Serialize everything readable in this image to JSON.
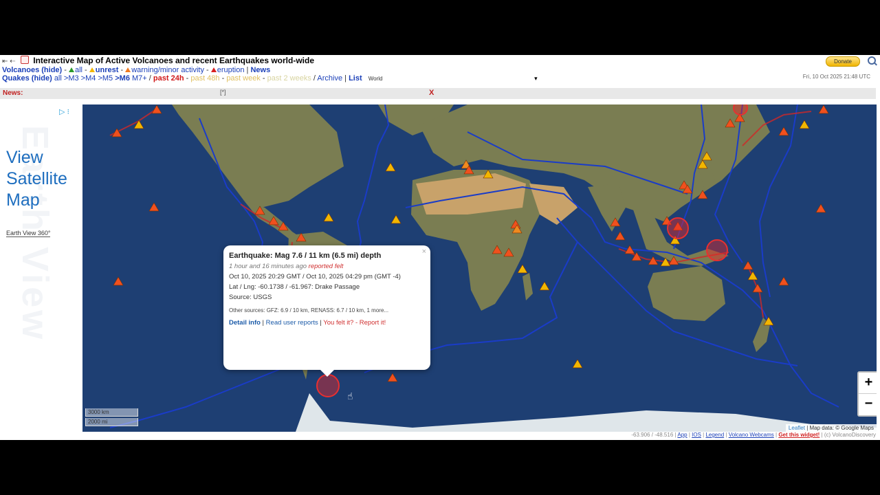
{
  "header": {
    "mini_icons": "⇤ ⇠",
    "title": "Interactive Map of Active Volcanoes and recent Earthquakes world-wide",
    "volcanoes": {
      "label": "Volcanoes (hide)",
      "all": "all",
      "unrest": "unrest",
      "warning": "warning/minor activity",
      "eruption": "eruption",
      "news": "News"
    },
    "quakes": {
      "label": "Quakes (hide)",
      "filters": [
        "all",
        ">M3",
        ">M4",
        ">M5",
        ">M6",
        "M7+"
      ],
      "past24": "past 24h",
      "past48": "past 48h",
      "pastweek": "past week",
      "past2weeks": "past 2 weeks",
      "archive": "Archive",
      "list": "List",
      "region": "World"
    },
    "donate": "Donate",
    "datetime": "Fri, 10 Oct 2025 21:48 UTC"
  },
  "newsbar": {
    "label": "News:",
    "mid": "[*]",
    "close": "X"
  },
  "ad": {
    "headline": "View Satellite Map",
    "link": "Earth View 360°",
    "watermark": "Earth View"
  },
  "map": {
    "ocean_color": "#1e3f73",
    "land_color": "#7a7d52",
    "desert_color": "#c8a26a",
    "ice_color": "#dfe6ea",
    "plate_color": "#1a3cc8",
    "volcano_colors": {
      "eruption": "#f0501e",
      "warning": "#f08a20",
      "unrest": "#f2b600"
    },
    "zoom_in": "+",
    "zoom_out": "−",
    "scale": [
      "3000 km",
      "2000 mi"
    ],
    "attribution_leaflet": "Leaflet",
    "attribution_data": "| Map data: © Google Maps"
  },
  "popup": {
    "title": "Earthquake: Mag 7.6 / 11 km (6.5 mi) depth",
    "ago": "1 hour and 16 minutes ago",
    "felt": "reported felt",
    "time": "Oct 10, 2025 20:29 GMT / Oct 10, 2025 04:29 pm (GMT -4)",
    "location": "Lat / Lng: -60.1738 / -61.967: Drake Passage",
    "source": "Source: USGS",
    "other": "Other sources: GFZ: 6.9 / 10 km, RENASS: 6.7 / 10 km, 1 more...",
    "detail": "Detail info",
    "read": "Read user reports",
    "felt_link": "You felt it? - Report it!",
    "close": "×"
  },
  "footer": {
    "coords": "-63.906 / -48.516",
    "app": "App",
    "ios": "IOS",
    "legend": "Legend",
    "webcams": "Volcano Webcams",
    "widget": "Get this widget!",
    "copyright": "(c) VolcanoDiscovery"
  }
}
